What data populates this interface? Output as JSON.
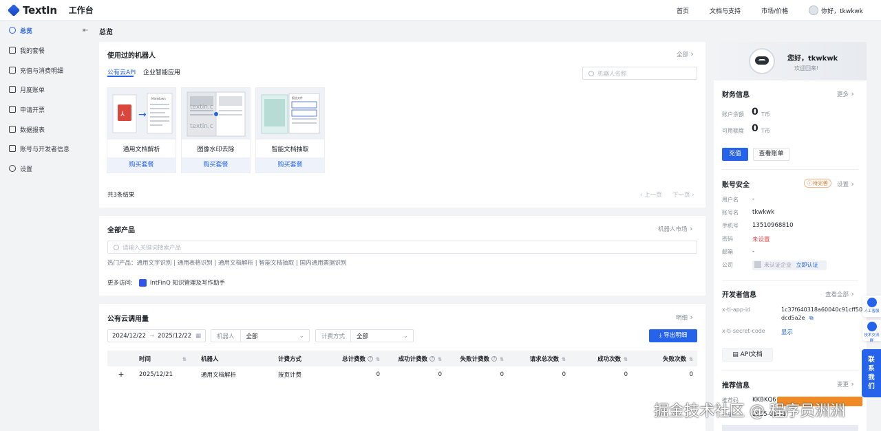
{
  "app": {
    "brand": "TextIn",
    "section": "工作台"
  },
  "topnav": {
    "home": "首页",
    "docs": "文档与支持",
    "market": "市场/价格",
    "user": "你好，tkwkwk"
  },
  "sidebar": {
    "items": [
      "总览",
      "我的套餐",
      "充值与消费明细",
      "月度账单",
      "申请开票",
      "数据报表",
      "账号与开发者信息",
      "设置"
    ]
  },
  "page_title": "总览",
  "robots_card": {
    "title": "使用过的机器人",
    "all_link": "全部",
    "tabs": [
      "公有云API",
      "企业智能应用"
    ],
    "search_placeholder": "机器人名称",
    "items": [
      {
        "name": "通用文档解析",
        "buy": "购买套餐"
      },
      {
        "name": "图像水印去除",
        "buy": "购买套餐"
      },
      {
        "name": "智能文档抽取",
        "buy": "购买套餐"
      }
    ],
    "total": "共3条结果",
    "prev": "上一页",
    "next": "下一页",
    "thumb_text": {
      "markdown": "Markdown",
      "watermark": "textin.c",
      "watermark2": "textin.c",
      "extract": "报告文件"
    }
  },
  "products_card": {
    "title": "全部产品",
    "link": "机器人市场",
    "search_placeholder": "请输入关键词搜索产品",
    "hot": "热门产品：通用文字识别 | 通用表格识别 | 通用文档解析 | 智能文档抽取 | 国内通用票据识别",
    "more_label": "更多访问:",
    "more_item": "IntFinQ 知识管理及写作助手"
  },
  "usage_card": {
    "title": "公有云调用量",
    "link": "明细",
    "date_start": "2024/12/22",
    "date_sep": "→",
    "date_end": "2025/12/22",
    "robot_label": "机器人",
    "robot_value": "全部",
    "billing_label": "计费方式",
    "billing_value": "全部",
    "export": "导出明细",
    "columns": [
      "时间",
      "机器人",
      "计费方式",
      "总计费数",
      "成功计费数",
      "失败计费数",
      "请求总次数",
      "成功次数",
      "失败次数"
    ],
    "rows": [
      {
        "expand": "+",
        "time": "2025/12/21",
        "robot": "通用文档解析",
        "billing": "按页计费",
        "total": "0",
        "success_bill": "0",
        "fail_bill": "0",
        "requests": "0",
        "success": "0",
        "fail": "0"
      }
    ]
  },
  "right_panel": {
    "greeting": "您好，tkwkwk",
    "welcome": "欢迎回来!",
    "finance": {
      "title": "财务信息",
      "more": "更多",
      "balance_label": "账户余额",
      "balance": "0",
      "unit": "T币",
      "credit_label": "可用额度",
      "credit": "0",
      "recharge": "充值",
      "bill": "查看账单"
    },
    "security": {
      "title": "账号安全",
      "badge": "待完善",
      "settings": "设置",
      "fields": [
        {
          "label": "用户名",
          "value": "-"
        },
        {
          "label": "账号名",
          "value": "tkwkwk"
        },
        {
          "label": "手机号",
          "value": "13510968810"
        },
        {
          "label": "密码",
          "value": "未设置"
        },
        {
          "label": "邮箱",
          "value": "-"
        },
        {
          "label": "公司",
          "value": "未认证企业"
        }
      ],
      "verify": "立即认证"
    },
    "developer": {
      "title": "开发者信息",
      "view_all": "查看全部",
      "app_id_label": "x-ti-app-id",
      "app_id_1": "1c37f640318a60040c91cff50",
      "app_id_2": "dcd5a2e",
      "secret_label": "x-ti-secret-code",
      "secret_show": "显示",
      "api_doc": "API文档"
    },
    "recommend": {
      "title": "推荐信息",
      "change": "变更",
      "row1_label": "推荐码",
      "row1_value": "KKBKQ6",
      "row2_label": "注册",
      "row2_value": "2025-01-01"
    }
  },
  "floats": {
    "human": "人工客服",
    "tech": "技术交流群",
    "contact": "联系我们"
  },
  "watermark": "掘金技术社区 @ 程序员洲洲",
  "colors": {
    "accent": "#2563eb",
    "warning": "#e0792c",
    "danger": "#e5484d",
    "page_bg": "#f2f3f5"
  }
}
